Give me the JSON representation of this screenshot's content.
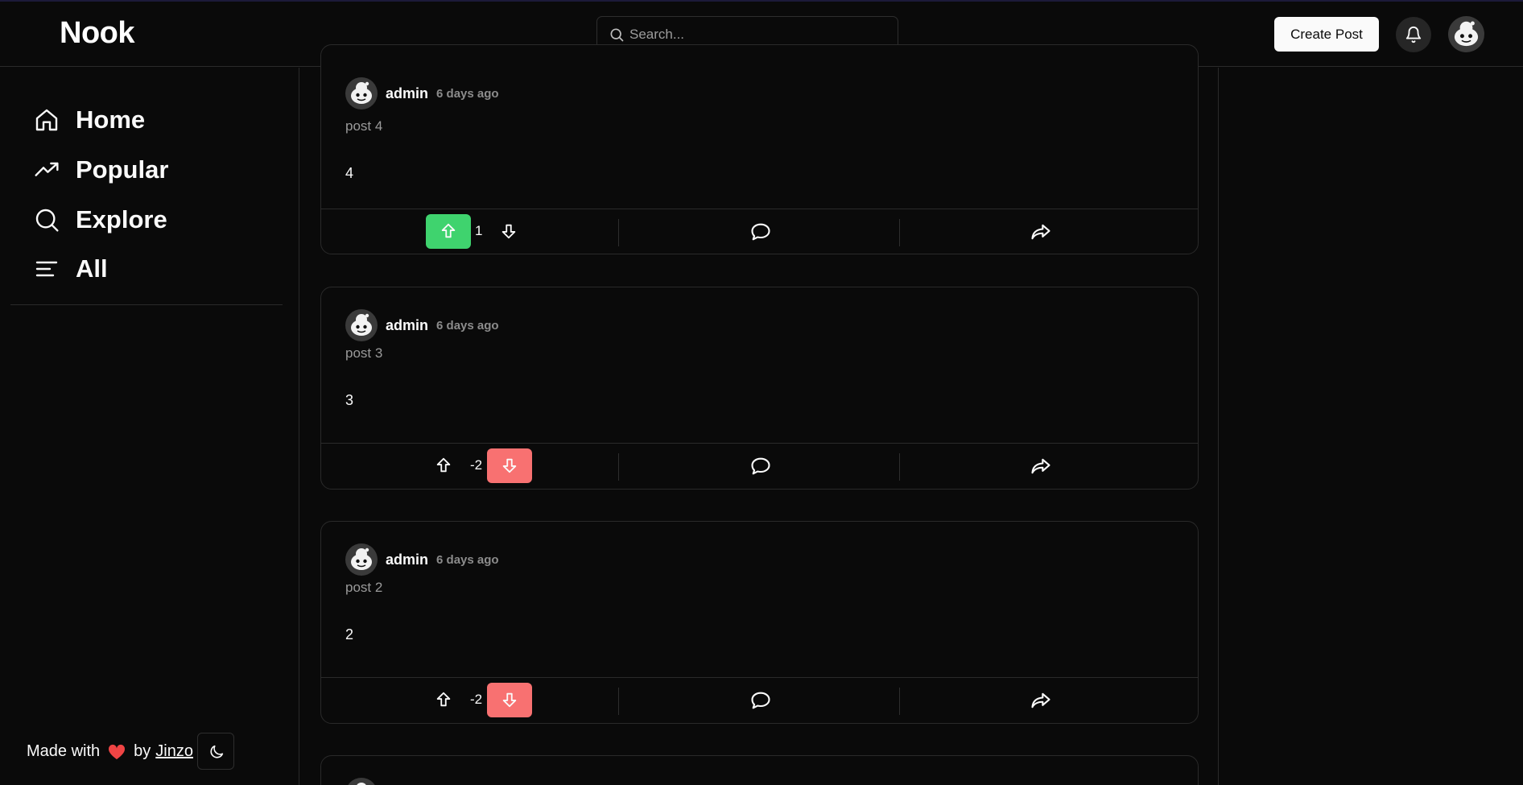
{
  "header": {
    "logo": "Nook",
    "search_placeholder": "Search...",
    "create_post_label": "Create Post"
  },
  "sidebar": {
    "items": [
      {
        "label": "Home",
        "icon": "home-icon"
      },
      {
        "label": "Popular",
        "icon": "trending-icon"
      },
      {
        "label": "Explore",
        "icon": "search-icon"
      },
      {
        "label": "All",
        "icon": "list-icon"
      }
    ],
    "footer": {
      "made_with": "Made with",
      "by": "by",
      "author_link": "Jinzo",
      "heart_color": "#ef4444"
    }
  },
  "colors": {
    "background": "#0a0a0a",
    "upvote_active": "#3fd36e",
    "downvote_active": "#f87171",
    "muted_text": "#8c8c8c"
  },
  "posts": [
    {
      "author": "admin",
      "time": "6 days ago",
      "title": "post 4",
      "body": "4",
      "score": "1",
      "vote": "up"
    },
    {
      "author": "admin",
      "time": "6 days ago",
      "title": "post 3",
      "body": "3",
      "score": "-2",
      "vote": "down"
    },
    {
      "author": "admin",
      "time": "6 days ago",
      "title": "post 2",
      "body": "2",
      "score": "-2",
      "vote": "down"
    }
  ]
}
